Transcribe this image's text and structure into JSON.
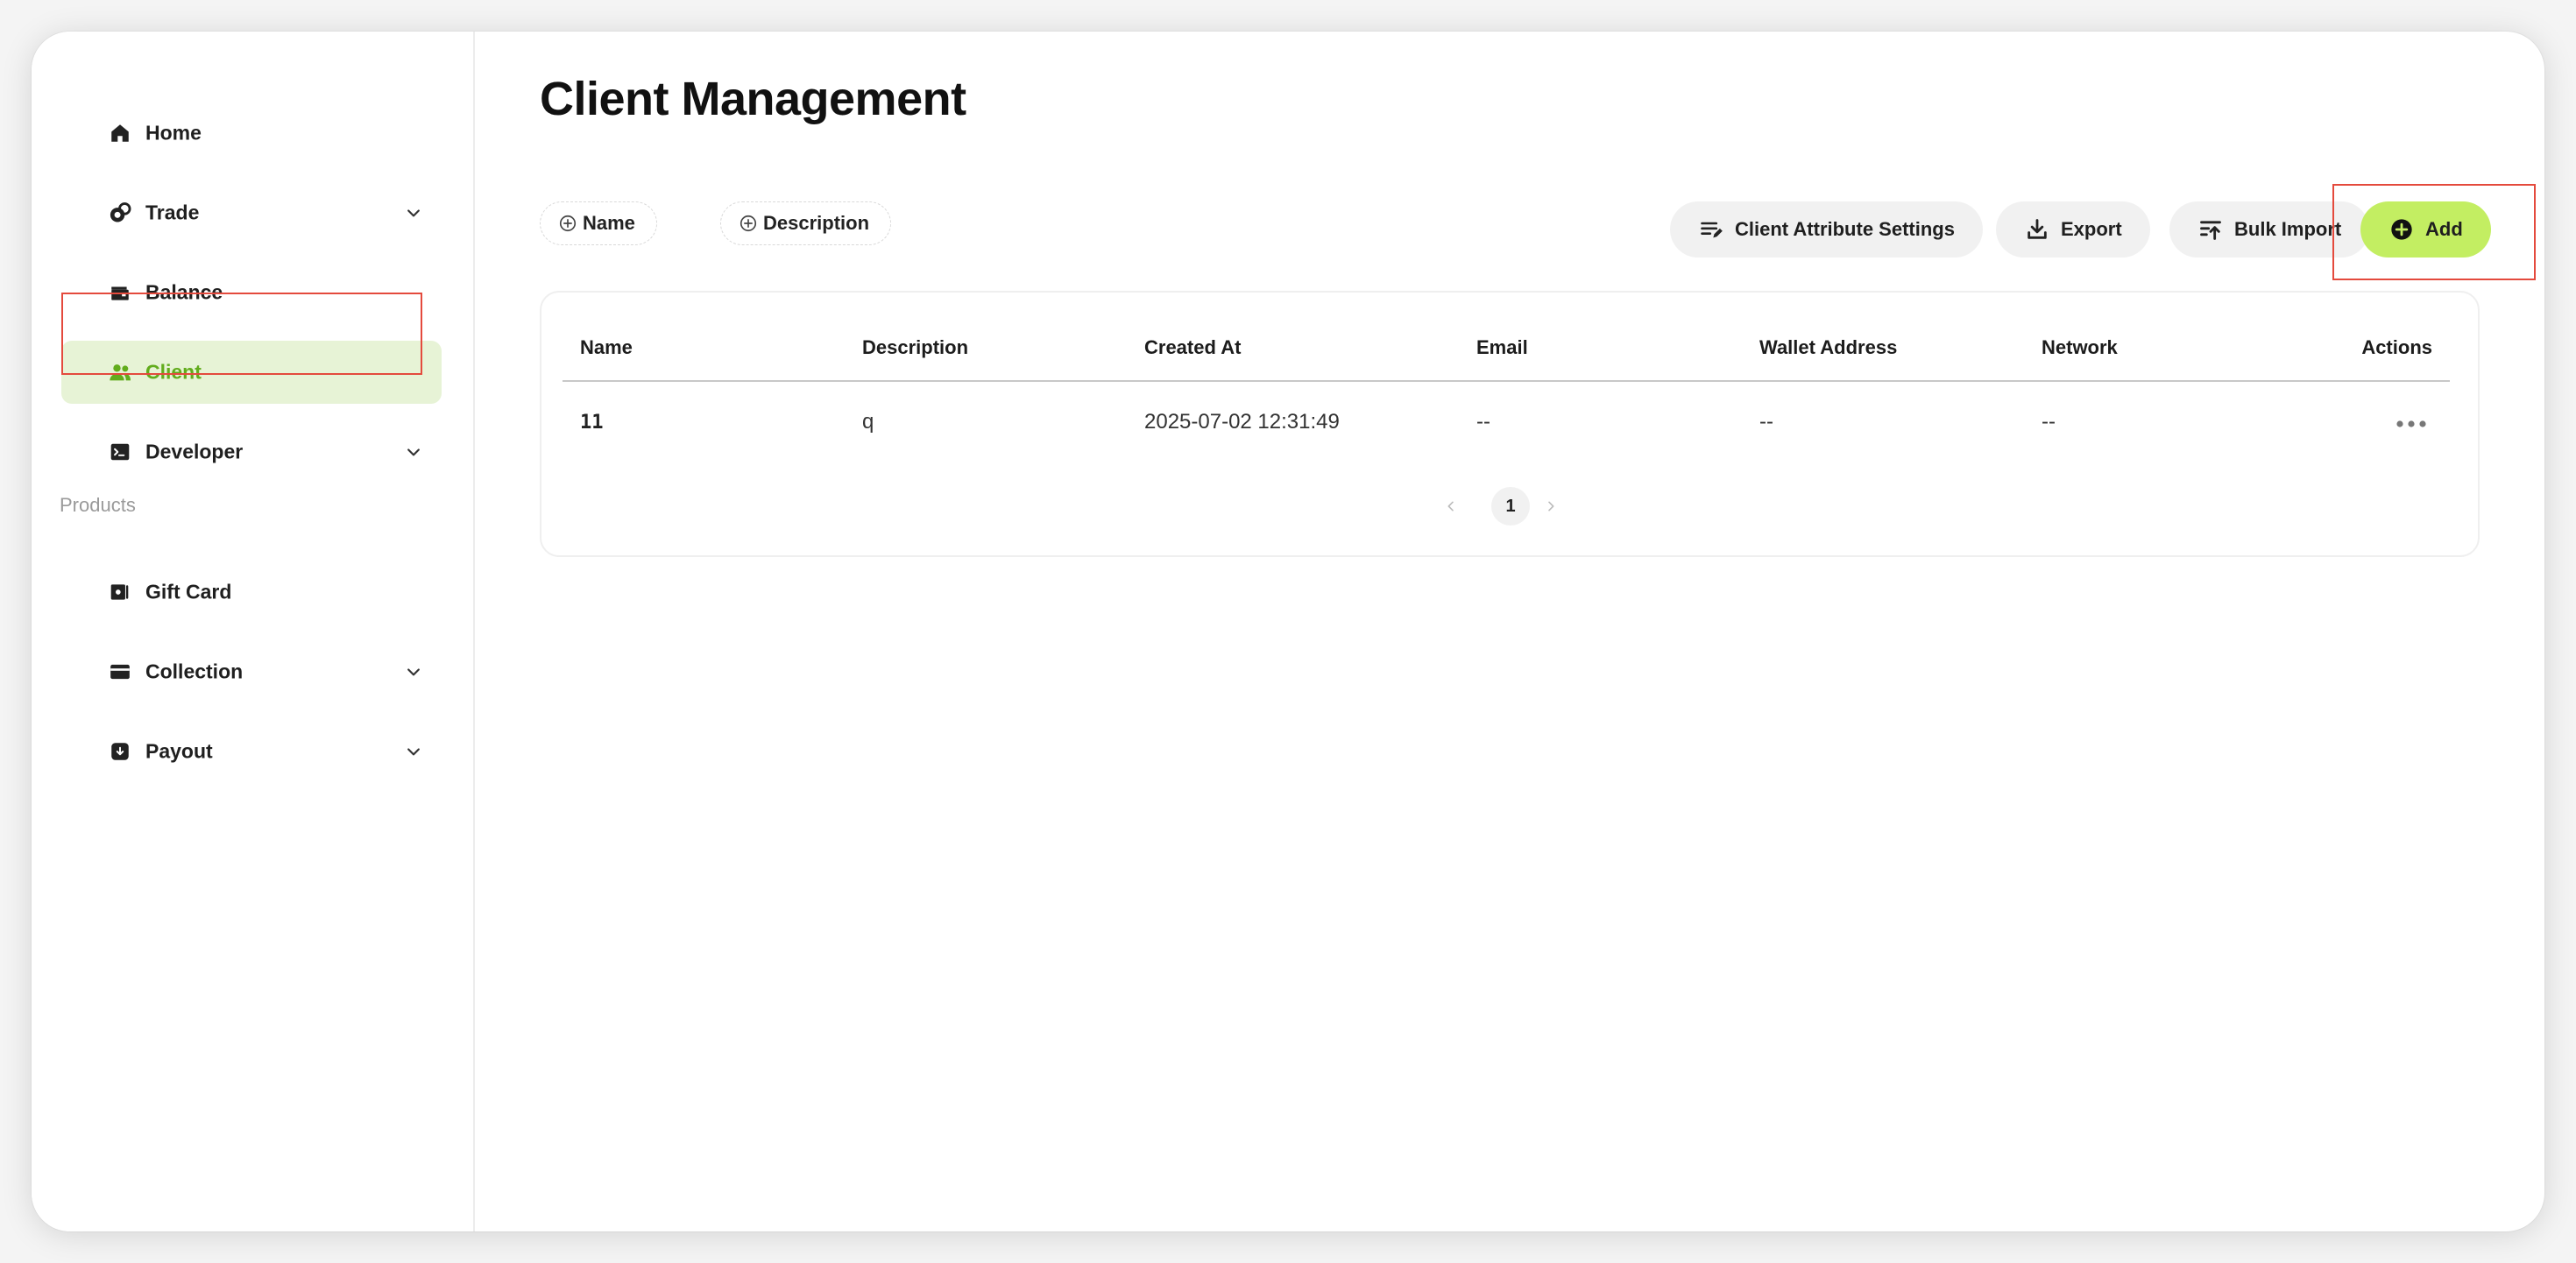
{
  "sidebar": {
    "items": [
      {
        "label": "Home",
        "icon": "home-icon"
      },
      {
        "label": "Trade",
        "icon": "coins-icon"
      },
      {
        "label": "Balance",
        "icon": "wallet-icon"
      },
      {
        "label": "Client",
        "icon": "users-icon"
      },
      {
        "label": "Developer",
        "icon": "terminal-icon"
      }
    ],
    "section_label": "Products",
    "product_items": [
      {
        "label": "Gift Card",
        "icon": "gift-card-icon"
      },
      {
        "label": "Collection",
        "icon": "card-icon"
      },
      {
        "label": "Payout",
        "icon": "payout-icon"
      }
    ]
  },
  "page": {
    "title": "Client Management"
  },
  "filters": {
    "name_chip": "Name",
    "description_chip": "Description"
  },
  "toolbar": {
    "attribute_settings": "Client Attribute Settings",
    "export": "Export",
    "bulk_import": "Bulk Import",
    "add": "Add"
  },
  "table": {
    "columns": [
      "Name",
      "Description",
      "Created At",
      "Email",
      "Wallet Address",
      "Network",
      "Actions"
    ],
    "rows": [
      {
        "name": "11",
        "description": "q",
        "created_at": "2025-07-02 12:31:49",
        "email": "--",
        "wallet_address": "--",
        "network": "--"
      }
    ]
  },
  "pagination": {
    "current_page": "1"
  },
  "colors": {
    "accent": "#c3ee62",
    "active_bg": "#e7f3d6",
    "active_text": "#62ac1c",
    "highlight": "#e44a3d"
  }
}
